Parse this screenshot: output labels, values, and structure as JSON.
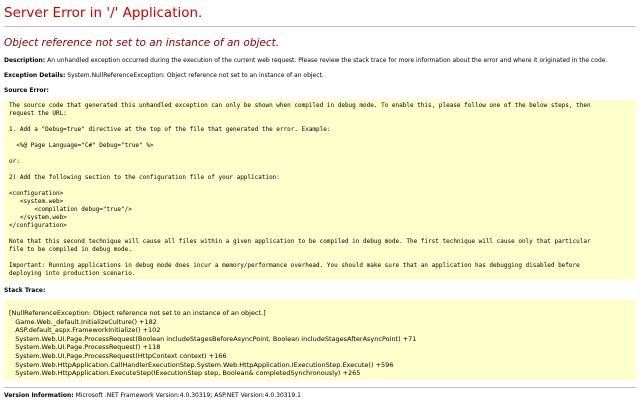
{
  "error": {
    "title": "Server Error in '/' Application.",
    "message": "Object reference not set to an instance of an object."
  },
  "description": {
    "label": "Description:",
    "text": "An unhandled exception occurred during the execution of the current web request. Please review the stack trace for more information about the error and where it originated in the code."
  },
  "exception_details": {
    "label": "Exception Details:",
    "text": "System.NullReferenceException: Object reference not set to an instance of an object."
  },
  "source_error": {
    "label": "Source Error:",
    "lines": [
      "The source code that generated this unhandled exception can only be shown when compiled in debug mode. To enable this, please follow one of the below steps, then",
      "request the URL:",
      "",
      "1. Add a \"Debug=true\" directive at the top of the file that generated the error. Example:",
      "",
      "  <%@ Page Language=\"C#\" Debug=\"true\" %>",
      "",
      "or:",
      "",
      "2) Add the following section to the configuration file of your application:",
      "",
      "<configuration>",
      "   <system.web>",
      "       <compilation debug=\"true\"/>",
      "   </system.web>",
      "</configuration>",
      "",
      "Note that this second technique will cause all files within a given application to be compiled in debug mode. The first technique will cause only that particular",
      "file to be compiled in debug mode.",
      "",
      "Important: Running applications in debug mode does incur a memory/performance overhead. You should make sure that an application has debugging disabled before",
      "deploying into production scenario."
    ]
  },
  "stack_trace": {
    "label": "Stack Trace:",
    "lines": [
      "[NullReferenceException: Object reference not set to an instance of an object.]",
      "   Game.Web._default.InitializeCulture() +182",
      "   ASP.default_aspx.FrameworkInitialize() +102",
      "   System.Web.UI.Page.ProcessRequest(Boolean includeStagesBeforeAsyncPoint, Boolean includeStagesAfterAsyncPoint) +71",
      "   System.Web.UI.Page.ProcessRequest() +118",
      "   System.Web.UI.Page.ProcessRequest(HttpContext context) +166",
      "   System.Web.HttpApplication.CallHandlerExecutionStep.System.Web.HttpApplication.IExecutionStep.Execute() +596",
      "   System.Web.HttpApplication.ExecuteStep(IExecutionStep step, Boolean& completedSynchronously) +265"
    ]
  },
  "version_info": {
    "label": "Version Information:",
    "text": "Microsoft .NET Framework Version:4.0.30319; ASP.NET Version:4.0.30319.1"
  },
  "colors": {
    "title": "#cc0000",
    "subtitle": "#8b0000",
    "code_background": "#ffffcc",
    "rule": "#c0c0c0"
  }
}
